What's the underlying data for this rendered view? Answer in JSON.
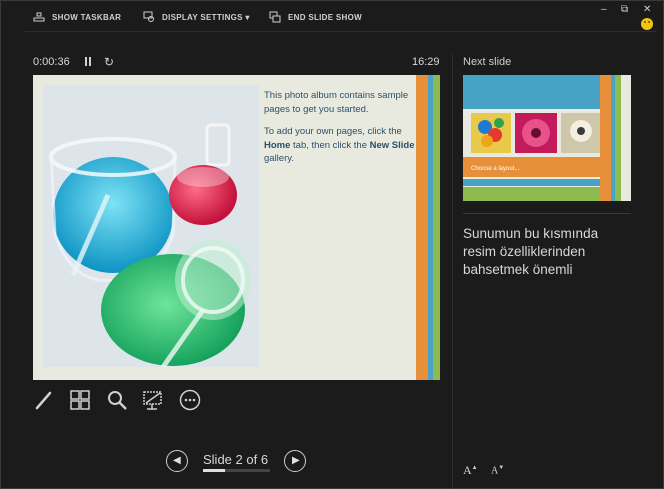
{
  "toolbar": {
    "show_taskbar": "SHOW TASKBAR",
    "display_settings": "DISPLAY SETTINGS ▾",
    "end_slide_show": "END SLIDE SHOW"
  },
  "window_controls": {
    "minimize": "–",
    "restore": "⧉",
    "close": "✕"
  },
  "presenter": {
    "elapsed_time": "0:00:36",
    "clock": "16:29",
    "slide_counter": "Slide 2 of 6",
    "progress": 0.333
  },
  "current_slide": {
    "paragraph1": "This photo album contains sample pages to get you started.",
    "p2_before_home": "To add your own pages, click the ",
    "p2_home": "Home",
    "p2_middle": " tab, then click the ",
    "p2_new_slide": "New Slide",
    "p2_end": " gallery.",
    "stripe_colors": [
      "#e88f3a",
      "#4ba3c6",
      "#8dbb4f"
    ]
  },
  "next_slide": {
    "label": "Next slide",
    "caption": "Choose a layout...",
    "bar_color": "#47a3c6",
    "accent": "#e88f3a"
  },
  "notes": {
    "text": "Sunumun bu kısmında resim özelliklerinden bahsetmek önemli"
  },
  "font_buttons": {
    "increase": "A",
    "decrease": "A"
  }
}
